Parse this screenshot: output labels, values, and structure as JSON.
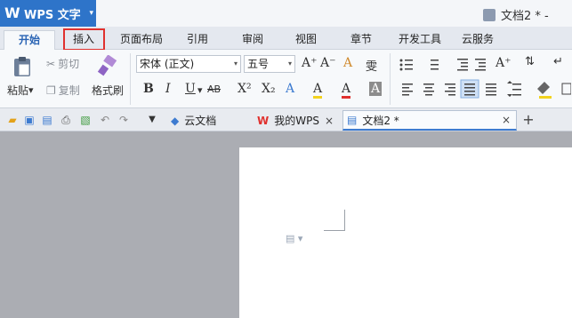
{
  "app": {
    "name": "WPS 文字",
    "logo_glyph": "W",
    "caret": "▾"
  },
  "window": {
    "title": "文档2 * -"
  },
  "ribbon_tabs": [
    "开始",
    "插入",
    "页面布局",
    "引用",
    "审阅",
    "视图",
    "章节",
    "开发工具",
    "云服务"
  ],
  "highlight_color": "#e0312e",
  "clipboard": {
    "paste": "粘贴",
    "cut": "剪切",
    "copy": "复制",
    "format_painter": "格式刷"
  },
  "font": {
    "family": "宋体 (正文)",
    "size": "五号",
    "dropdown": "▾"
  },
  "format_buttons": {
    "bold": "B",
    "italic": "I",
    "underline": "U",
    "strike": "AB",
    "superscript": "X²",
    "subscript": "X₂",
    "text_effect": "A",
    "highlight": "A",
    "font_color": "A",
    "char_shading": "A",
    "grow": "A⁺",
    "shrink": "A⁻",
    "clear": "A",
    "phonetic": "雯"
  },
  "doc_tabs": [
    {
      "label": "云文档",
      "icon": "cube-icon"
    },
    {
      "label": "我的WPS",
      "close": "×"
    },
    {
      "label": "文档2 *",
      "close": "×"
    }
  ],
  "new_tab": "+"
}
